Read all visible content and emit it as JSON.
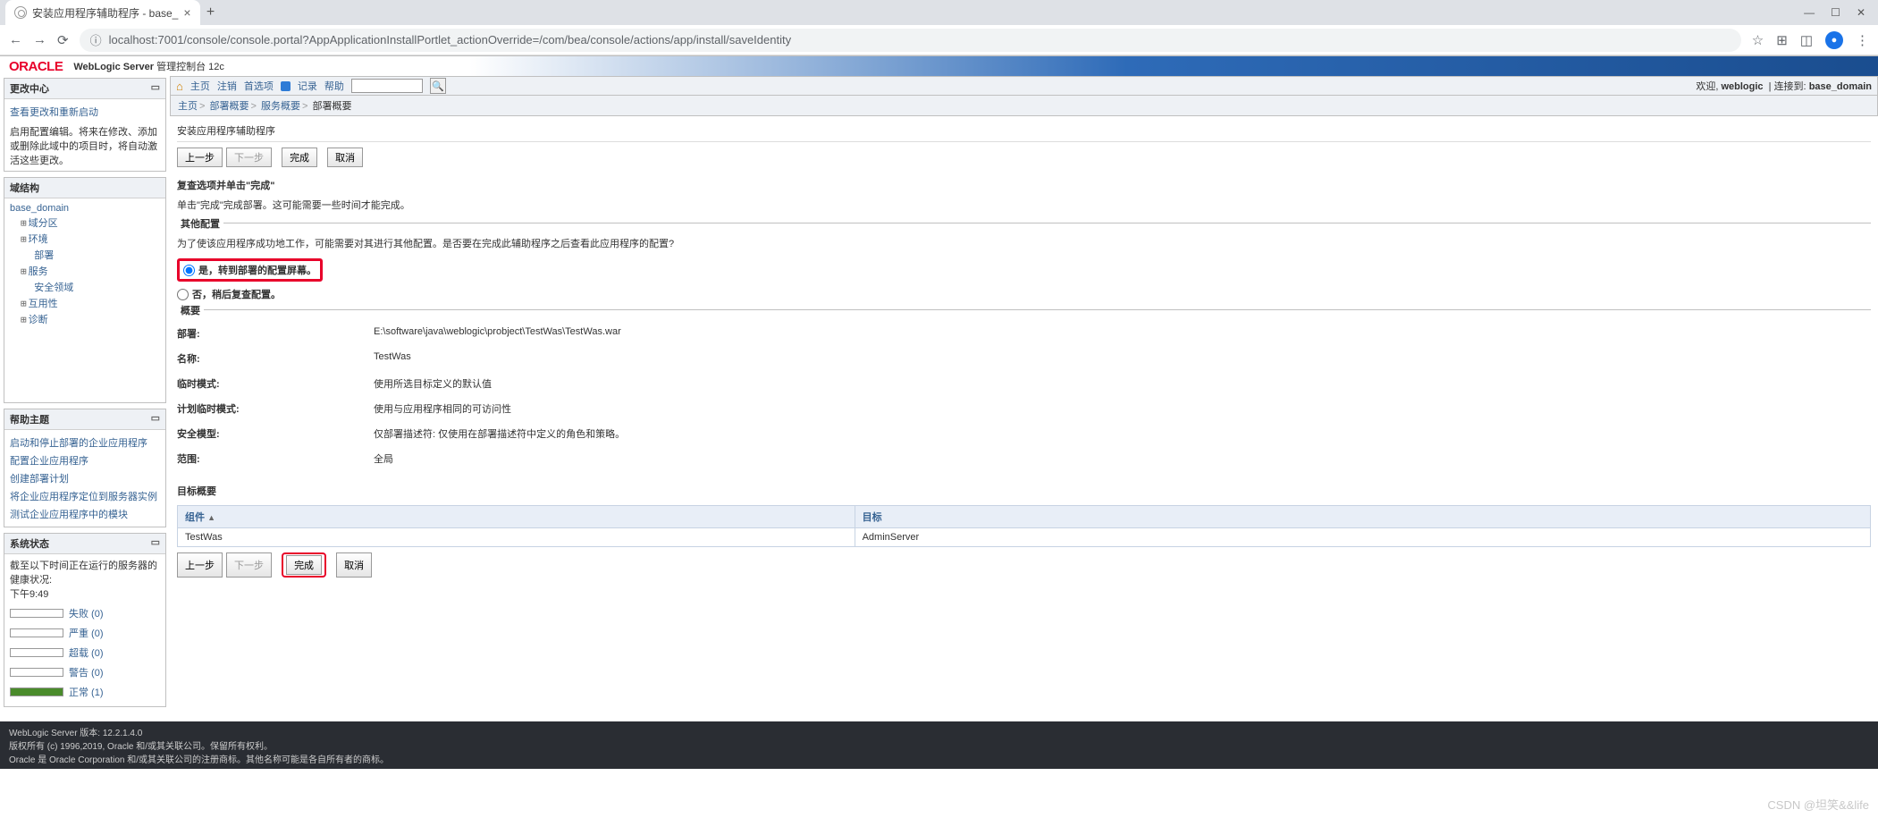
{
  "browser": {
    "tab_title": "安装应用程序辅助程序 - base_",
    "url": "localhost:7001/console/console.portal?AppApplicationInstallPortlet_actionOverride=/com/bea/console/actions/app/install/saveIdentity",
    "min": "—",
    "max": "☐",
    "close": "✕"
  },
  "header": {
    "logo": "ORACLE",
    "product": "WebLogic Server",
    "suffix": "管理控制台 12c"
  },
  "toolbar": {
    "home": "主页",
    "logout": "注销",
    "prefs": "首选项",
    "record": "记录",
    "help": "帮助",
    "welcome_prefix": "欢迎,",
    "welcome_user": "weblogic",
    "connected_prefix": "连接到:",
    "connected_to": "base_domain"
  },
  "crumb": {
    "c1": "主页",
    "c2": "部署概要",
    "c3": "服务概要",
    "c4": "部署概要"
  },
  "left": {
    "change": {
      "title": "更改中心",
      "link": "查看更改和重新启动",
      "desc": "启用配置编辑。将来在修改、添加或删除此域中的项目时，将自动激活这些更改。"
    },
    "struct": {
      "title": "域结构",
      "root": "base_domain",
      "items": [
        "域分区",
        "环境",
        "部署",
        "服务",
        "安全领域",
        "互用性",
        "诊断"
      ]
    },
    "help": {
      "title": "帮助主题",
      "links": [
        "启动和停止部署的企业应用程序",
        "配置企业应用程序",
        "创建部署计划",
        "将企业应用程序定位到服务器实例",
        "测试企业应用程序中的模块"
      ]
    },
    "status": {
      "title": "系统状态",
      "desc": "截至以下时间正在运行的服务器的健康状况:",
      "time": "下午9:49",
      "rows": [
        {
          "label": "失败 (0)"
        },
        {
          "label": "严重 (0)"
        },
        {
          "label": "超载 (0)"
        },
        {
          "label": "警告 (0)"
        },
        {
          "label": "正常 (1)",
          "ok": true
        }
      ]
    }
  },
  "main": {
    "title": "安装应用程序辅助程序",
    "btn_back": "上一步",
    "btn_next": "下一步",
    "btn_finish": "完成",
    "btn_cancel": "取消",
    "review_h": "复查选项并单击\"完成\"",
    "review_p": "单击\"完成\"完成部署。这可能需要一些时间才能完成。",
    "other_legend": "其他配置",
    "other_p": "为了使该应用程序成功地工作，可能需要对其进行其他配置。是否要在完成此辅助程序之后查看此应用程序的配置?",
    "radio_yes": "是，转到部署的配置屏幕。",
    "radio_no": "否，稍后复查配置。",
    "summary_legend": "概要",
    "rows": [
      {
        "k": "部署:",
        "v": "E:\\software\\java\\weblogic\\probject\\TestWas\\TestWas.war"
      },
      {
        "k": "名称:",
        "v": "TestWas"
      },
      {
        "k": "临时模式:",
        "v": "使用所选目标定义的默认值"
      },
      {
        "k": "计划临时模式:",
        "v": "使用与应用程序相同的可访问性"
      },
      {
        "k": "安全模型:",
        "v": "仅部署描述符: 仅使用在部署描述符中定义的角色和策略。"
      },
      {
        "k": "范围:",
        "v": "全局"
      }
    ],
    "target_h": "目标概要",
    "th_comp": "组件",
    "th_target": "目标",
    "td_comp": "TestWas",
    "td_target": "AdminServer"
  },
  "footer": {
    "l1": "WebLogic Server 版本: 12.2.1.4.0",
    "l2": "版权所有 (c) 1996,2019, Oracle 和/或其关联公司。保留所有权利。",
    "l3": "Oracle 是 Oracle Corporation 和/或其关联公司的注册商标。其他名称可能是各自所有者的商标。"
  },
  "watermark": "CSDN @坦笑&&life"
}
